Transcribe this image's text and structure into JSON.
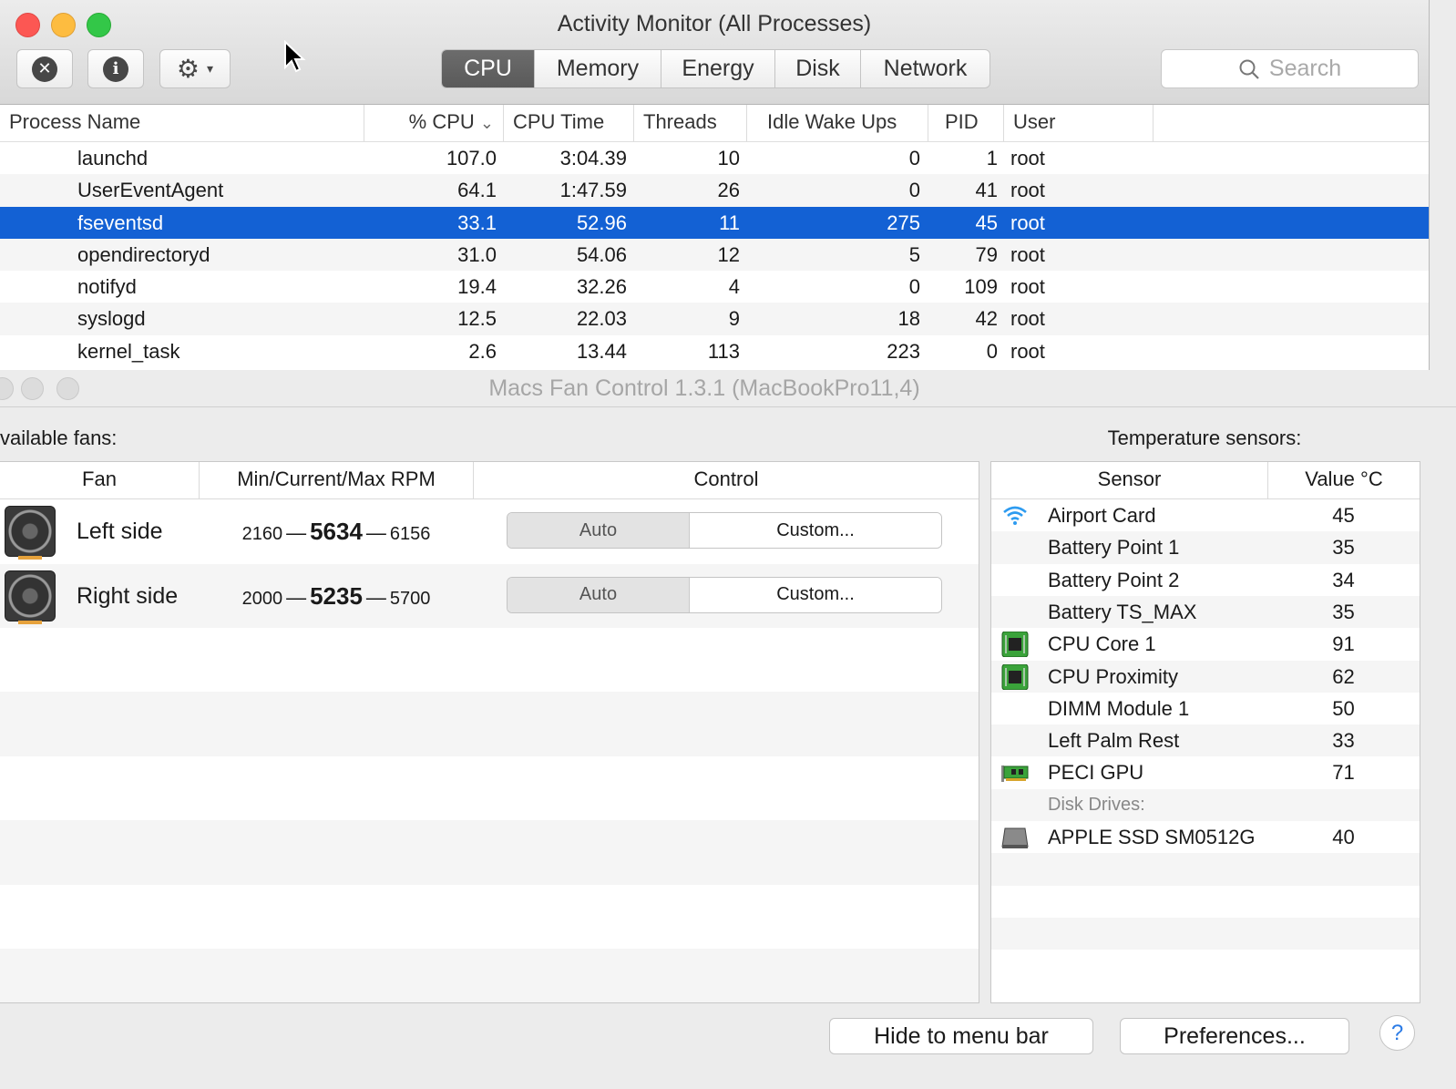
{
  "activity_monitor": {
    "title": "Activity Monitor (All Processes)",
    "tabs": [
      {
        "label": "CPU",
        "active": true
      },
      {
        "label": "Memory",
        "active": false
      },
      {
        "label": "Energy",
        "active": false
      },
      {
        "label": "Disk",
        "active": false
      },
      {
        "label": "Network",
        "active": false
      }
    ],
    "search_placeholder": "Search",
    "columns": [
      "Process Name",
      "% CPU",
      "CPU Time",
      "Threads",
      "Idle Wake Ups",
      "PID",
      "User"
    ],
    "sort_indicator": "⌄",
    "rows": [
      {
        "name": "launchd",
        "cpu": "107.0",
        "time": "3:04.39",
        "threads": "10",
        "wakeups": "0",
        "pid": "1",
        "user": "root"
      },
      {
        "name": "UserEventAgent",
        "cpu": "64.1",
        "time": "1:47.59",
        "threads": "26",
        "wakeups": "0",
        "pid": "41",
        "user": "root"
      },
      {
        "name": "fseventsd",
        "cpu": "33.1",
        "time": "52.96",
        "threads": "11",
        "wakeups": "275",
        "pid": "45",
        "user": "root",
        "selected": true
      },
      {
        "name": "opendirectoryd",
        "cpu": "31.0",
        "time": "54.06",
        "threads": "12",
        "wakeups": "5",
        "pid": "79",
        "user": "root"
      },
      {
        "name": "notifyd",
        "cpu": "19.4",
        "time": "32.26",
        "threads": "4",
        "wakeups": "0",
        "pid": "109",
        "user": "root"
      },
      {
        "name": "syslogd",
        "cpu": "12.5",
        "time": "22.03",
        "threads": "9",
        "wakeups": "18",
        "pid": "42",
        "user": "root"
      },
      {
        "name": "kernel_task",
        "cpu": "2.6",
        "time": "13.44",
        "threads": "113",
        "wakeups": "223",
        "pid": "0",
        "user": "root"
      }
    ],
    "colors": {
      "selection": "#1361d4",
      "close": "#fc5753",
      "minimize": "#fdbc40",
      "zoom": "#33c748"
    }
  },
  "fan_control": {
    "title": "Macs Fan Control 1.3.1 (MacBookPro11,4)",
    "fans_label": "vailable fans:",
    "sensors_label": "Temperature sensors:",
    "fan_columns": [
      "Fan",
      "Min/Current/Max RPM",
      "Control"
    ],
    "fans": [
      {
        "name": "Left side",
        "min": "2160",
        "current": "5634",
        "max": "6156",
        "auto_label": "Auto",
        "custom_label": "Custom..."
      },
      {
        "name": "Right side",
        "min": "2000",
        "current": "5235",
        "max": "5700",
        "auto_label": "Auto",
        "custom_label": "Custom..."
      }
    ],
    "sensor_columns": [
      "Sensor",
      "Value °C"
    ],
    "sensors": [
      {
        "name": "Airport Card",
        "value": "45",
        "icon": "wifi-icon"
      },
      {
        "name": "Battery Point 1",
        "value": "35",
        "icon": ""
      },
      {
        "name": "Battery Point 2",
        "value": "34",
        "icon": ""
      },
      {
        "name": "Battery TS_MAX",
        "value": "35",
        "icon": ""
      },
      {
        "name": "CPU Core 1",
        "value": "91",
        "icon": "cpu-chip-icon"
      },
      {
        "name": "CPU Proximity",
        "value": "62",
        "icon": "cpu-chip-icon"
      },
      {
        "name": "DIMM Module 1",
        "value": "50",
        "icon": ""
      },
      {
        "name": "Left Palm Rest",
        "value": "33",
        "icon": ""
      },
      {
        "name": "PECI GPU",
        "value": "71",
        "icon": "gpu-card-icon"
      }
    ],
    "disk_group_label": "Disk Drives:",
    "disks": [
      {
        "name": "APPLE SSD SM0512G",
        "value": "40",
        "icon": "ssd-drive-icon"
      }
    ],
    "hide_button": "Hide to menu bar",
    "preferences_button": "Preferences...",
    "help_button": "?"
  }
}
